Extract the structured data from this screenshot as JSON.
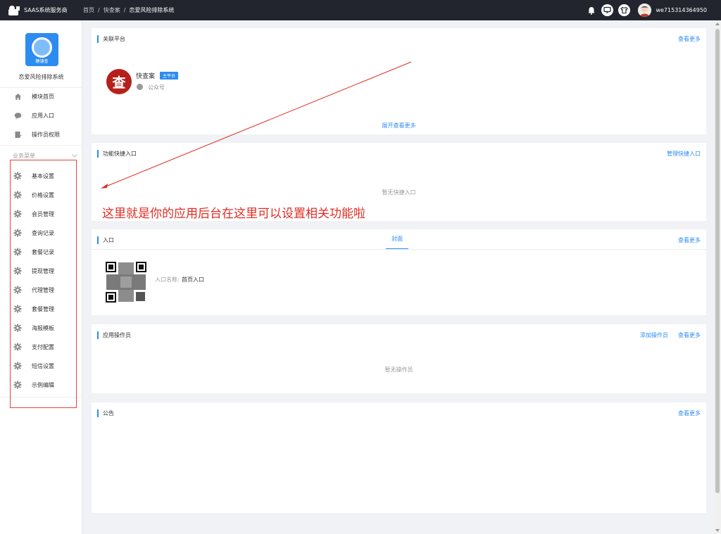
{
  "topbar": {
    "brand": "SAAS系统服务商",
    "breadcrumb": [
      "首页",
      "快查案",
      "恋爱风险排除系统"
    ],
    "username": "we715314364950"
  },
  "sidebar": {
    "app_icon_caption": "糖溏查",
    "app_name": "恋爱风险排除系统",
    "top_items": [
      {
        "label": "模块首页",
        "icon": "home-icon"
      },
      {
        "label": "应用入口",
        "icon": "chat-bubble-icon"
      },
      {
        "label": "操作员权限",
        "icon": "document-edit-icon"
      }
    ],
    "group_title": "业务菜单",
    "business_items": [
      {
        "label": "基本设置",
        "icon": "gear-icon"
      },
      {
        "label": "价格设置",
        "icon": "gear-icon"
      },
      {
        "label": "会员管理",
        "icon": "gear-icon"
      },
      {
        "label": "查询记录",
        "icon": "gear-icon"
      },
      {
        "label": "套餐记录",
        "icon": "gear-icon"
      },
      {
        "label": "提现管理",
        "icon": "gear-icon"
      },
      {
        "label": "代理管理",
        "icon": "gear-icon"
      },
      {
        "label": "套餐管理",
        "icon": "gear-icon"
      },
      {
        "label": "海报模板",
        "icon": "gear-icon"
      },
      {
        "label": "支付配置",
        "icon": "gear-icon"
      },
      {
        "label": "短信设置",
        "icon": "gear-icon"
      },
      {
        "label": "示例编辑",
        "icon": "gear-icon"
      }
    ]
  },
  "cards": {
    "platform": {
      "title": "关联平台",
      "more": "查看更多",
      "logo_char": "查",
      "name": "快查案",
      "badge": "主平台",
      "type": "公众号",
      "expand": "展开查看更多"
    },
    "shortcuts": {
      "title": "功能快捷入口",
      "manage": "管理快捷入口",
      "empty": "暂无快捷入口"
    },
    "entry": {
      "title": "入口",
      "tab": "封面",
      "more": "查看更多",
      "name_label": "入口名称:",
      "name_value": "首页入口"
    },
    "operators": {
      "title": "应用操作员",
      "add": "添加操作员",
      "more": "查看更多",
      "empty": "暂无操作员"
    },
    "notice": {
      "title": "公告",
      "more": "查看更多"
    }
  },
  "annotation": "这里就是你的应用后台在这里可以设置相关功能啦",
  "colors": {
    "topbar_bg": "#22252d",
    "accent": "#2d8cf0",
    "annotation_red": "#e02d24",
    "logo_red": "#b5201c"
  }
}
